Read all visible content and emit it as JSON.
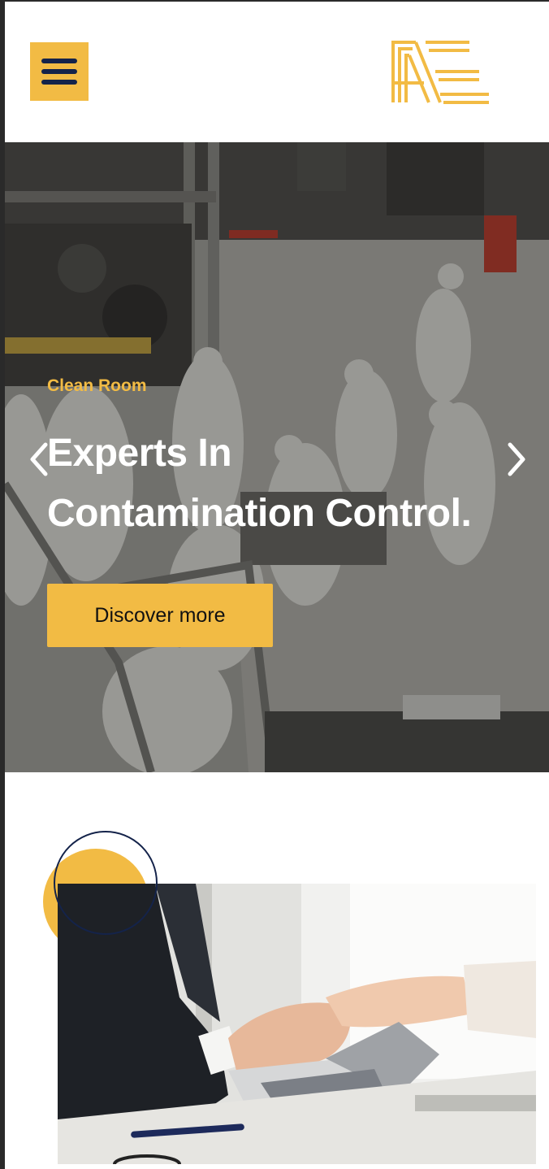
{
  "header": {
    "menu_icon": "hamburger-menu-icon",
    "logo_icon": "ae-monogram-logo",
    "colors": {
      "accent": "#f2bb44",
      "navy": "#14234a"
    }
  },
  "hero": {
    "eyebrow": "Clean Room",
    "title_line1": "Experts In",
    "title_line2": "Contamination Control.",
    "cta_label": "Discover more",
    "prev_icon": "chevron-left-icon",
    "next_icon": "chevron-right-icon",
    "image_alt": "clean-room-technicians-photo"
  },
  "about": {
    "image_alt": "business-handshake-photo"
  }
}
